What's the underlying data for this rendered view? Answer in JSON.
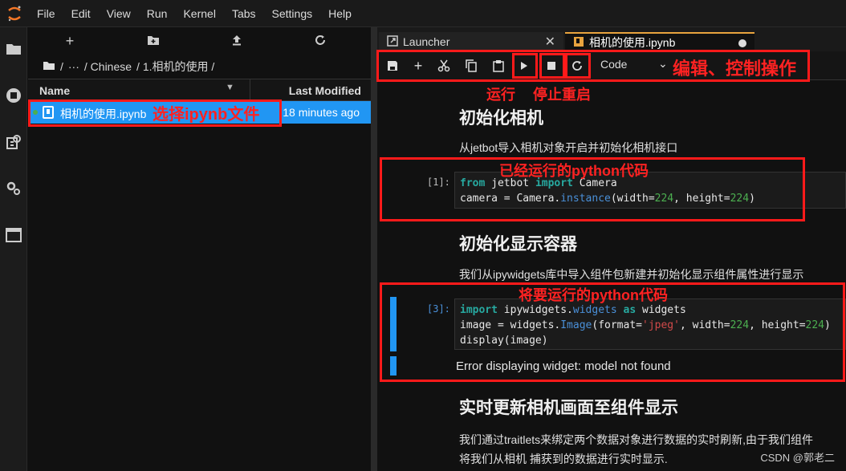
{
  "menubar": {
    "items": [
      "File",
      "Edit",
      "View",
      "Run",
      "Kernel",
      "Tabs",
      "Settings",
      "Help"
    ]
  },
  "filebrowser": {
    "breadcrumb": [
      "/",
      "···",
      "/ Chinese",
      "/ 1.相机的使用 /"
    ],
    "columns": {
      "name": "Name",
      "modified": "Last Modified"
    },
    "files": [
      {
        "name": "相机的使用.ipynb",
        "modified": "18 minutes ago"
      }
    ]
  },
  "tabs": {
    "launcher": "Launcher",
    "active": "相机的使用.ipynb"
  },
  "toolbar": {
    "cell_type": "Code"
  },
  "notebook": {
    "h1": "初始化相机",
    "p1": "从jetbot导入相机对象开启并初始化相机接口",
    "cell1_prompt": "[1]:",
    "h2": "初始化显示容器",
    "p2": "我们从ipywidgets库中导入组件包新建并初始化显示组件属性进行显示",
    "cell2_prompt": "[3]:",
    "output_error": "Error displaying widget: model not found",
    "h3": "实时更新相机画面至组件显示",
    "p3a": "我们通过traitlets来绑定两个数据对象进行数据的实时刷新,由于我们组件",
    "p3b": "将我们从相机 捕获到的数据进行实时显示."
  },
  "annotations": {
    "select_file": "选择ipynb文件",
    "edit_control": "编辑、控制操作",
    "run": "运行",
    "stop_restart": "停止重启",
    "executed_code": "已经运行的python代码",
    "to_run_code": "将要运行的python代码"
  },
  "watermark": "CSDN @郭老二",
  "colors": {
    "accent": "#2196f3",
    "annotation": "#ff1a1a",
    "tab_active": "#e8a33e"
  }
}
